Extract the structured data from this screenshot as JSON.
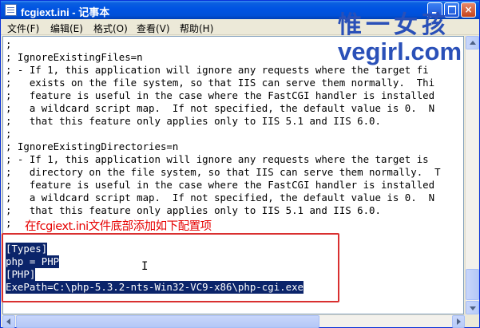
{
  "window": {
    "title": "fcgiext.ini - 记事本",
    "minimize_icon": "minimize-icon",
    "maximize_icon": "maximize-icon",
    "close_label": "×"
  },
  "menu": [
    "文件(F)",
    "编辑(E)",
    "格式(O)",
    "查看(V)",
    "帮助(H)"
  ],
  "editor": {
    "lines": [
      ";",
      "; IgnoreExistingFiles=n",
      "; - If 1, this application will ignore any requests where the target fi",
      ";   exists on the file system, so that IIS can serve them normally.  Thi",
      ";   feature is useful in the case where the FastCGI handler is installed",
      ";   a wildcard script map.  If not specified, the default value is 0.  N",
      ";   that this feature only applies only to IIS 5.1 and IIS 6.0.",
      ";",
      "; IgnoreExistingDirectories=n",
      "; - If 1, this application will ignore any requests where the target is",
      ";   directory on the file system, so that IIS can serve them normally.  T",
      ";   feature is useful in the case where the FastCGI handler is installed",
      ";   a wildcard script map.  If not specified, the default value is 0.  N",
      ";   that this feature only applies only to IIS 5.1 and IIS 6.0.",
      ";"
    ],
    "selected_lines": [
      "[Types]",
      "php = PHP",
      "[PHP]",
      "ExePath=C:\\php-5.3.2-nts-Win32-VC9-x86\\php-cgi.exe"
    ]
  },
  "annotation": {
    "text": "在fcgiext.ini文件底部添加如下配置项",
    "color": "#e60000"
  },
  "watermark": {
    "chinese": "惟一女孩",
    "url": "vegirl.com"
  },
  "colors": {
    "titlebar": "#0053e2",
    "selection": "#0b246a",
    "highlight_border": "#d93030",
    "watermark": "#2a50b8"
  }
}
